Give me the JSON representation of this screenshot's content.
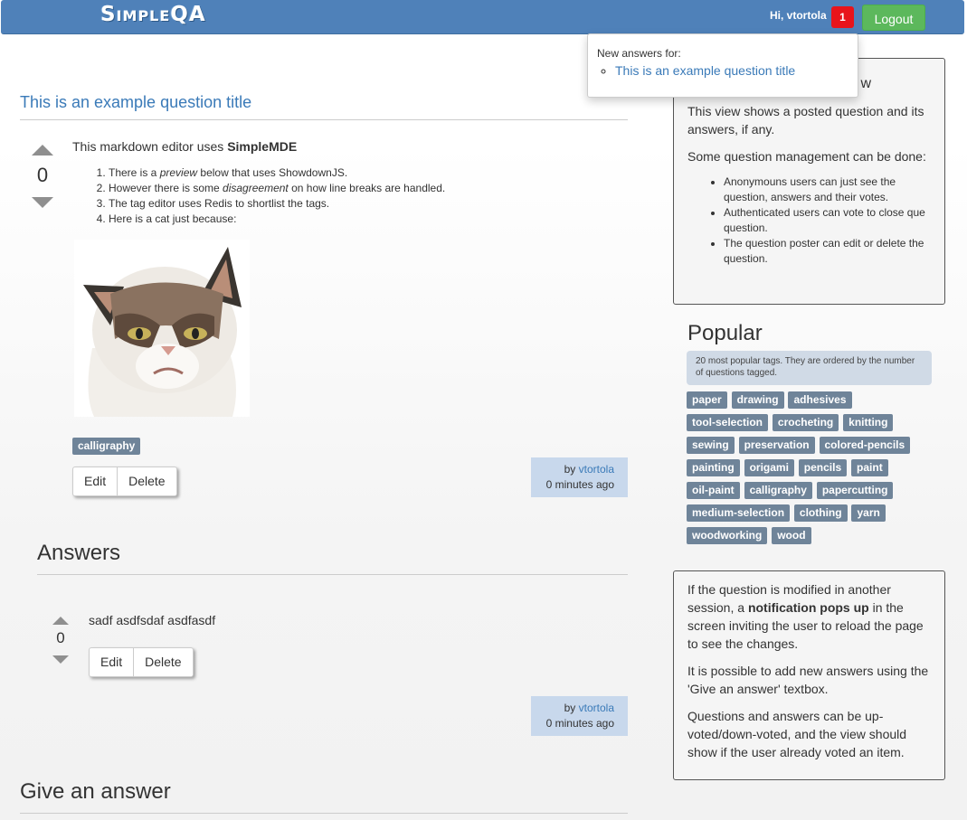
{
  "header": {
    "brand": "SimpleQA",
    "greeting": "Hi, vtortola",
    "notification_count": "1",
    "logout_label": "Logout"
  },
  "notifications": {
    "heading": "New answers for:",
    "items": [
      {
        "label": "This is an example question title"
      }
    ]
  },
  "question": {
    "title": "This is an example question title",
    "votes": "0",
    "intro_text": "This markdown editor uses ",
    "intro_bold": "SimpleMDE",
    "list": [
      {
        "pre": "There is a ",
        "em": "preview",
        "post": " below that uses ShowdownJS."
      },
      {
        "pre": "However there is some ",
        "em": "disagreement",
        "post": " on how line breaks are handled."
      },
      {
        "pre": "The tag editor uses Redis to shortlist the tags.",
        "em": "",
        "post": ""
      },
      {
        "pre": "Here is a cat just because:",
        "em": "",
        "post": ""
      }
    ],
    "tag": "calligraphy",
    "edit_label": "Edit",
    "delete_label": "Delete",
    "by_label": "by",
    "author": "vtortola",
    "time": "0 minutes ago"
  },
  "answers": {
    "heading": "Answers",
    "items": [
      {
        "votes": "0",
        "text": "sadf asdfsdaf asdfasdf",
        "edit_label": "Edit",
        "delete_label": "Delete",
        "by_label": "by",
        "author": "vtortola",
        "time": "0 minutes ago"
      }
    ]
  },
  "give_answer": {
    "heading": "Give an answer"
  },
  "sidebar": {
    "info_panel": {
      "title_visible": "w",
      "p1": "This view shows a posted question and its answers, if any.",
      "p2": "Some question management can be done:",
      "items": [
        "Anonymouns users can just see the question, answers and their votes.",
        "Authenticated users can vote to close que question.",
        "The question poster can edit or delete the question."
      ]
    },
    "popular": {
      "title": "Popular",
      "note": "20 most popular tags. They are ordered by the number of questions tagged.",
      "rows": [
        [
          "paper",
          "drawing",
          "adhesives"
        ],
        [
          "tool-selection",
          "crocheting",
          "knitting"
        ],
        [
          "sewing",
          "preservation",
          "colored-pencils"
        ],
        [
          "painting",
          "origami",
          "pencils",
          "paint"
        ],
        [
          "oil-paint",
          "calligraphy",
          "papercutting"
        ],
        [
          "medium-selection",
          "clothing",
          "yarn"
        ],
        [
          "woodworking",
          "wood"
        ]
      ]
    },
    "notes_panel": {
      "p1_pre": "If the question is modified in another session, a ",
      "p1_bold": "notification pops up",
      "p1_post": " in the screen inviting the user to reload the page to see the changes.",
      "p2": "It is possible to add new answers using the 'Give an answer' textbox.",
      "p3": "Questions and answers can be up-voted/down-voted, and the view should show if the user already voted an item."
    }
  },
  "colors": {
    "navbar": "#4f81b9",
    "link": "#3a7ab8",
    "badge": "#e8141b",
    "logout": "#5cb85c",
    "tag": "#6f8499",
    "byline_bg": "#c8d8ec"
  }
}
